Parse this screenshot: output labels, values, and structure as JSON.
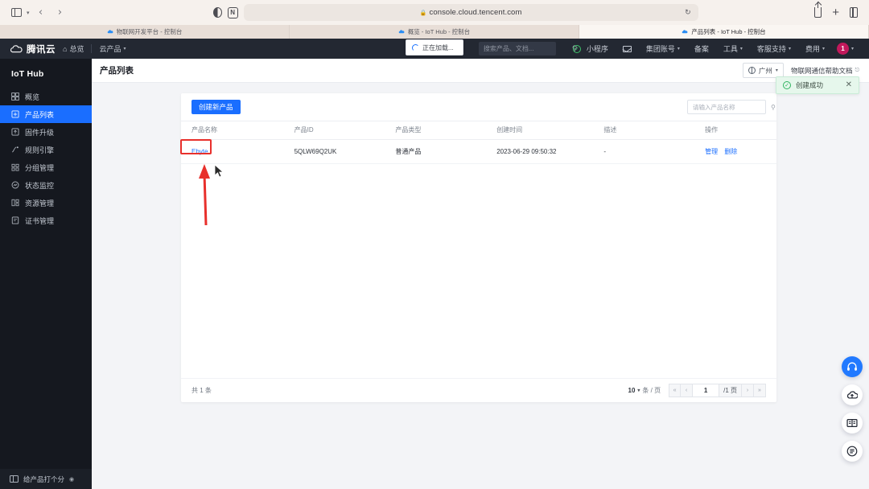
{
  "browser": {
    "url": "console.cloud.tencent.com",
    "lock_icon": "lock-icon",
    "reload_icon": "reload-icon",
    "back_icon": "back-arrow-icon",
    "forward_icon": "forward-arrow-icon",
    "sidebar_icon": "sidebar-toggle-icon",
    "reader_icon": "reader-mode-icon",
    "extension_icon": "extension-icon",
    "share_icon": "share-icon",
    "newtab_icon": "plus-icon",
    "tabsview_icon": "tab-overview-icon",
    "tabs": [
      {
        "title": "物联网开发平台 - 控制台",
        "favicon": "tencent-cloud-favicon",
        "active": false
      },
      {
        "title": "概览 - IoT Hub - 控制台",
        "favicon": "tencent-cloud-favicon",
        "active": false
      },
      {
        "title": "产品列表 - IoT Hub - 控制台",
        "favicon": "tencent-cloud-favicon",
        "active": true
      }
    ]
  },
  "top_nav": {
    "brand": "腾讯云",
    "brand_icon": "tencent-cloud-logo",
    "home_label": "总览",
    "home_icon": "home-icon",
    "products_label": "云产品",
    "search_placeholder": "搜索产品、文档...",
    "search_icon": "search-icon",
    "right_items": [
      {
        "label": "小程序",
        "icon": "mini-program-icon"
      },
      {
        "label": "",
        "icon": "mail-icon"
      },
      {
        "label": "集团账号",
        "icon": "chevron-down-icon"
      },
      {
        "label": "备案",
        "icon": ""
      },
      {
        "label": "工具",
        "icon": "chevron-down-icon"
      },
      {
        "label": "客服支持",
        "icon": "chevron-down-icon"
      },
      {
        "label": "费用",
        "icon": "chevron-down-icon"
      }
    ],
    "avatar_badge": "1",
    "avatar_color": "#c2185b"
  },
  "loading_tooltip": {
    "label": "正在加载...",
    "icon": "spinner-icon"
  },
  "sidebar": {
    "title": "IoT Hub",
    "items": [
      {
        "label": "概览",
        "icon": "dashboard-icon",
        "active": false
      },
      {
        "label": "产品列表",
        "icon": "product-list-icon",
        "active": true
      },
      {
        "label": "固件升级",
        "icon": "firmware-upgrade-icon",
        "active": false
      },
      {
        "label": "规则引擎",
        "icon": "rule-engine-icon",
        "active": false
      },
      {
        "label": "分组管理",
        "icon": "group-management-icon",
        "active": false
      },
      {
        "label": "状态监控",
        "icon": "status-monitor-icon",
        "active": false
      },
      {
        "label": "资源管理",
        "icon": "resource-management-icon",
        "active": false
      },
      {
        "label": "证书管理",
        "icon": "certificate-management-icon",
        "active": false
      }
    ],
    "footer_label": "给产品打个分",
    "footer_icon": "rate-icon",
    "collapse_icon": "collapse-sidebar-icon"
  },
  "page": {
    "title": "产品列表",
    "region": "广州",
    "region_icon": "globe-icon",
    "region_caret": "chevron-down-icon",
    "help_link": "物联网通信帮助文档",
    "help_icon": "external-link-icon"
  },
  "toast": {
    "message": "创建成功",
    "icon": "check-circle-icon",
    "close_icon": "close-icon",
    "accent": "#2fb35f",
    "background": "#e6f7ec"
  },
  "toolbar": {
    "create_label": "创建新产品",
    "accent": "#1a6eff",
    "search_placeholder": "请输入产品名称",
    "search_icon": "search-icon"
  },
  "table": {
    "columns": [
      "产品名称",
      "产品ID",
      "产品类型",
      "创建时间",
      "描述",
      "操作"
    ],
    "rows": [
      {
        "name": "Ebyte",
        "id": "5QLW69Q2UK",
        "type": "普通产品",
        "created": "2023-06-29 09:50:32",
        "description": "-",
        "actions": [
          "管理",
          "删除"
        ]
      }
    ]
  },
  "pagination": {
    "total_label": "共 1 条",
    "page_size": "10",
    "page_size_unit": "条 / 页",
    "page_size_caret": "chevron-down-icon",
    "current_page": "1",
    "total_pages_label": "/1 页",
    "first_icon": "first-page-icon",
    "prev_icon": "prev-page-icon",
    "next_icon": "next-page-icon",
    "last_icon": "last-page-icon"
  },
  "rail": [
    {
      "icon": "headset-support-icon",
      "primary": true
    },
    {
      "icon": "cloud-upload-icon",
      "primary": false
    },
    {
      "icon": "documentation-book-icon",
      "primary": false
    },
    {
      "icon": "feedback-list-icon",
      "primary": false
    }
  ],
  "annotation": {
    "highlight_color": "#e8302c",
    "target": "Ebyte"
  }
}
